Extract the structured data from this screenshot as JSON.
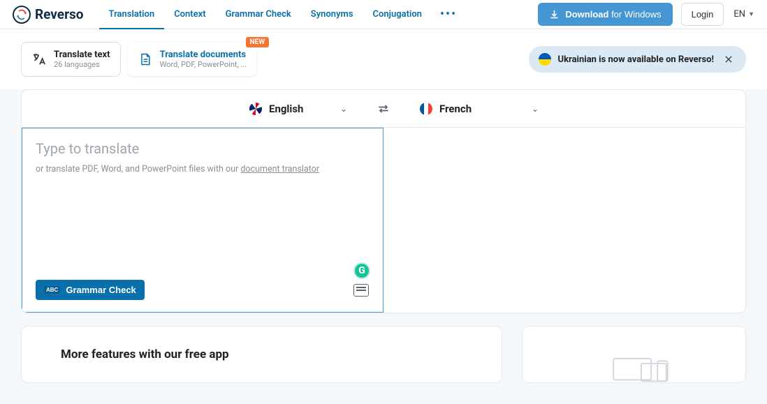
{
  "brand": "Reverso",
  "nav": {
    "items": [
      "Translation",
      "Context",
      "Grammar Check",
      "Synonyms",
      "Conjugation"
    ]
  },
  "header": {
    "download_prefix": "Download",
    "download_suffix": " for Windows",
    "login": "Login",
    "ui_lang": "EN"
  },
  "modes": {
    "text": {
      "title": "Translate text",
      "sub": "26 languages"
    },
    "docs": {
      "title": "Translate documents",
      "sub": "Word, PDF, PowerPoint, ...",
      "badge": "NEW"
    }
  },
  "promo": {
    "text": "Ukrainian is now available on Reverso!"
  },
  "translator": {
    "src_lang": "English",
    "dst_lang": "French",
    "placeholder": "Type to translate",
    "helper_prefix": "or translate PDF, Word, and PowerPoint files with our ",
    "helper_link": "document translator",
    "grammar_btn": "Grammar Check",
    "grammar_badge": "ABC"
  },
  "features": {
    "title": "More features with our free app"
  }
}
